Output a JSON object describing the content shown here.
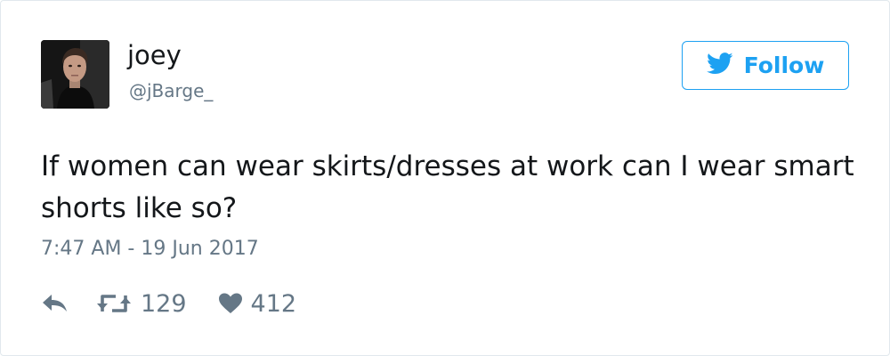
{
  "user": {
    "display_name": "joey",
    "handle": "@jBarge_"
  },
  "follow_button": {
    "label": "Follow",
    "icon": "twitter-bird-icon"
  },
  "tweet": {
    "text": "If women can wear skirts/dresses at work can I wear smart shorts like so?",
    "timestamp": "7:47 AM - 19 Jun 2017"
  },
  "actions": {
    "reply_icon": "reply-icon",
    "retweet_icon": "retweet-icon",
    "retweet_count": "129",
    "like_icon": "heart-icon",
    "like_count": "412"
  },
  "colors": {
    "accent": "#1da1f2",
    "text": "#14171a",
    "muted": "#657786",
    "border": "#e1e8ed"
  }
}
